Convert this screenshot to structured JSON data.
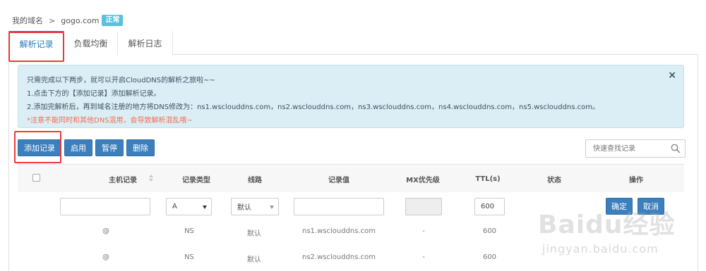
{
  "breadcrumb": {
    "parent": "我的域名",
    "separator": ">",
    "domain": "gogo.com",
    "status_badge": "正常"
  },
  "tabs": [
    {
      "label": "解析记录",
      "active": true
    },
    {
      "label": "负载均衡"
    },
    {
      "label": "解析日志"
    }
  ],
  "alert": {
    "line1": "只需完成以下两步，就可以开启CloudDNS的解析之旅啦~~",
    "line2": "1.点击下方的【添加记录】添加解析记录。",
    "line3": "2.添加完解析后，再到域名注册的地方将DNS修改为：ns1.wsclouddns.com，ns2.wsclouddns.com，ns3.wsclouddns.com，ns4.wsclouddns.com，ns5.wsclouddns.com。",
    "warning": "*注意不能同时和其他DNS混用，会导致解析混乱哦~",
    "close": "×"
  },
  "toolbar": {
    "add": "添加记录",
    "enable": "启用",
    "pause": "暂停",
    "delete": "删除"
  },
  "search": {
    "placeholder": "快速查找记录"
  },
  "table": {
    "headers": {
      "host": "主机记录",
      "type": "记录类型",
      "line": "线路",
      "value": "记录值",
      "mx": "MX优先级",
      "ttl": "TTL(s)",
      "status": "状态",
      "actions": "操作"
    },
    "new_row": {
      "host": "",
      "type": "A",
      "line": "默认",
      "value": "",
      "mx": "",
      "ttl": "600",
      "confirm": "确定",
      "cancel": "取消"
    },
    "rows": [
      {
        "host": "@",
        "type": "NS",
        "line": "默认",
        "value": "ns1.wsclouddns.com",
        "mx": "-",
        "ttl": "600"
      },
      {
        "host": "@",
        "type": "NS",
        "line": "默认",
        "value": "ns2.wsclouddns.com",
        "mx": "-",
        "ttl": "600"
      }
    ]
  },
  "watermark": {
    "main": "Baidu经验",
    "sub": "jingyan.baidu.com"
  },
  "colors": {
    "primary": "#3b7fbd",
    "alert_bg": "#dbeef6",
    "warning": "#f06c4f",
    "highlight": "#e83a3a",
    "badge": "#5bc0de"
  }
}
